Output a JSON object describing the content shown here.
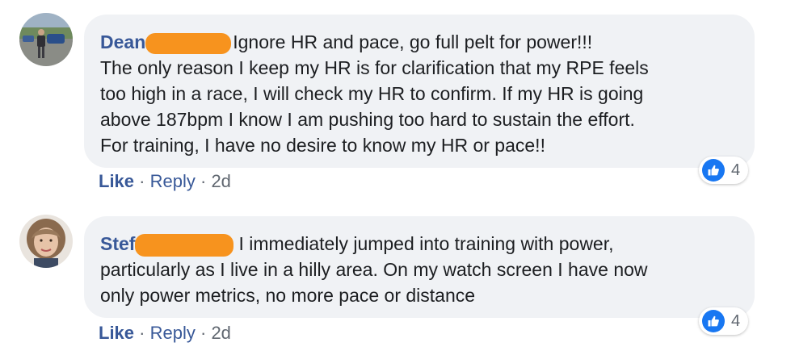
{
  "colors": {
    "author": "#385898",
    "bubble": "#f0f2f5",
    "redaction": "#f7931e",
    "like_reaction": "#1877f2",
    "meta": "#606770"
  },
  "comments": [
    {
      "author": "Dean",
      "lines": [
        "Ignore HR and pace, go full pelt for power!!!",
        "The only reason I keep my HR is for clarification that my RPE feels",
        "too high in a race, I will check my HR to confirm. If my HR is going",
        "above 187bpm I know I am pushing too hard to sustain the effort.",
        "For training, I have no desire to know my HR or pace!!"
      ],
      "like_label": "Like",
      "reply_label": "Reply",
      "separator": "·",
      "time": "2d",
      "reaction_icon": "thumbs-up-icon",
      "reaction_count": "4"
    },
    {
      "author": "Stef",
      "lines": [
        "I immediately jumped into training with power,",
        "particularly as I live in a hilly area. On my watch screen I have now",
        "only power metrics, no more pace or distance"
      ],
      "like_label": "Like",
      "reply_label": "Reply",
      "separator": "·",
      "time": "2d",
      "reaction_icon": "thumbs-up-icon",
      "reaction_count": "4"
    }
  ]
}
